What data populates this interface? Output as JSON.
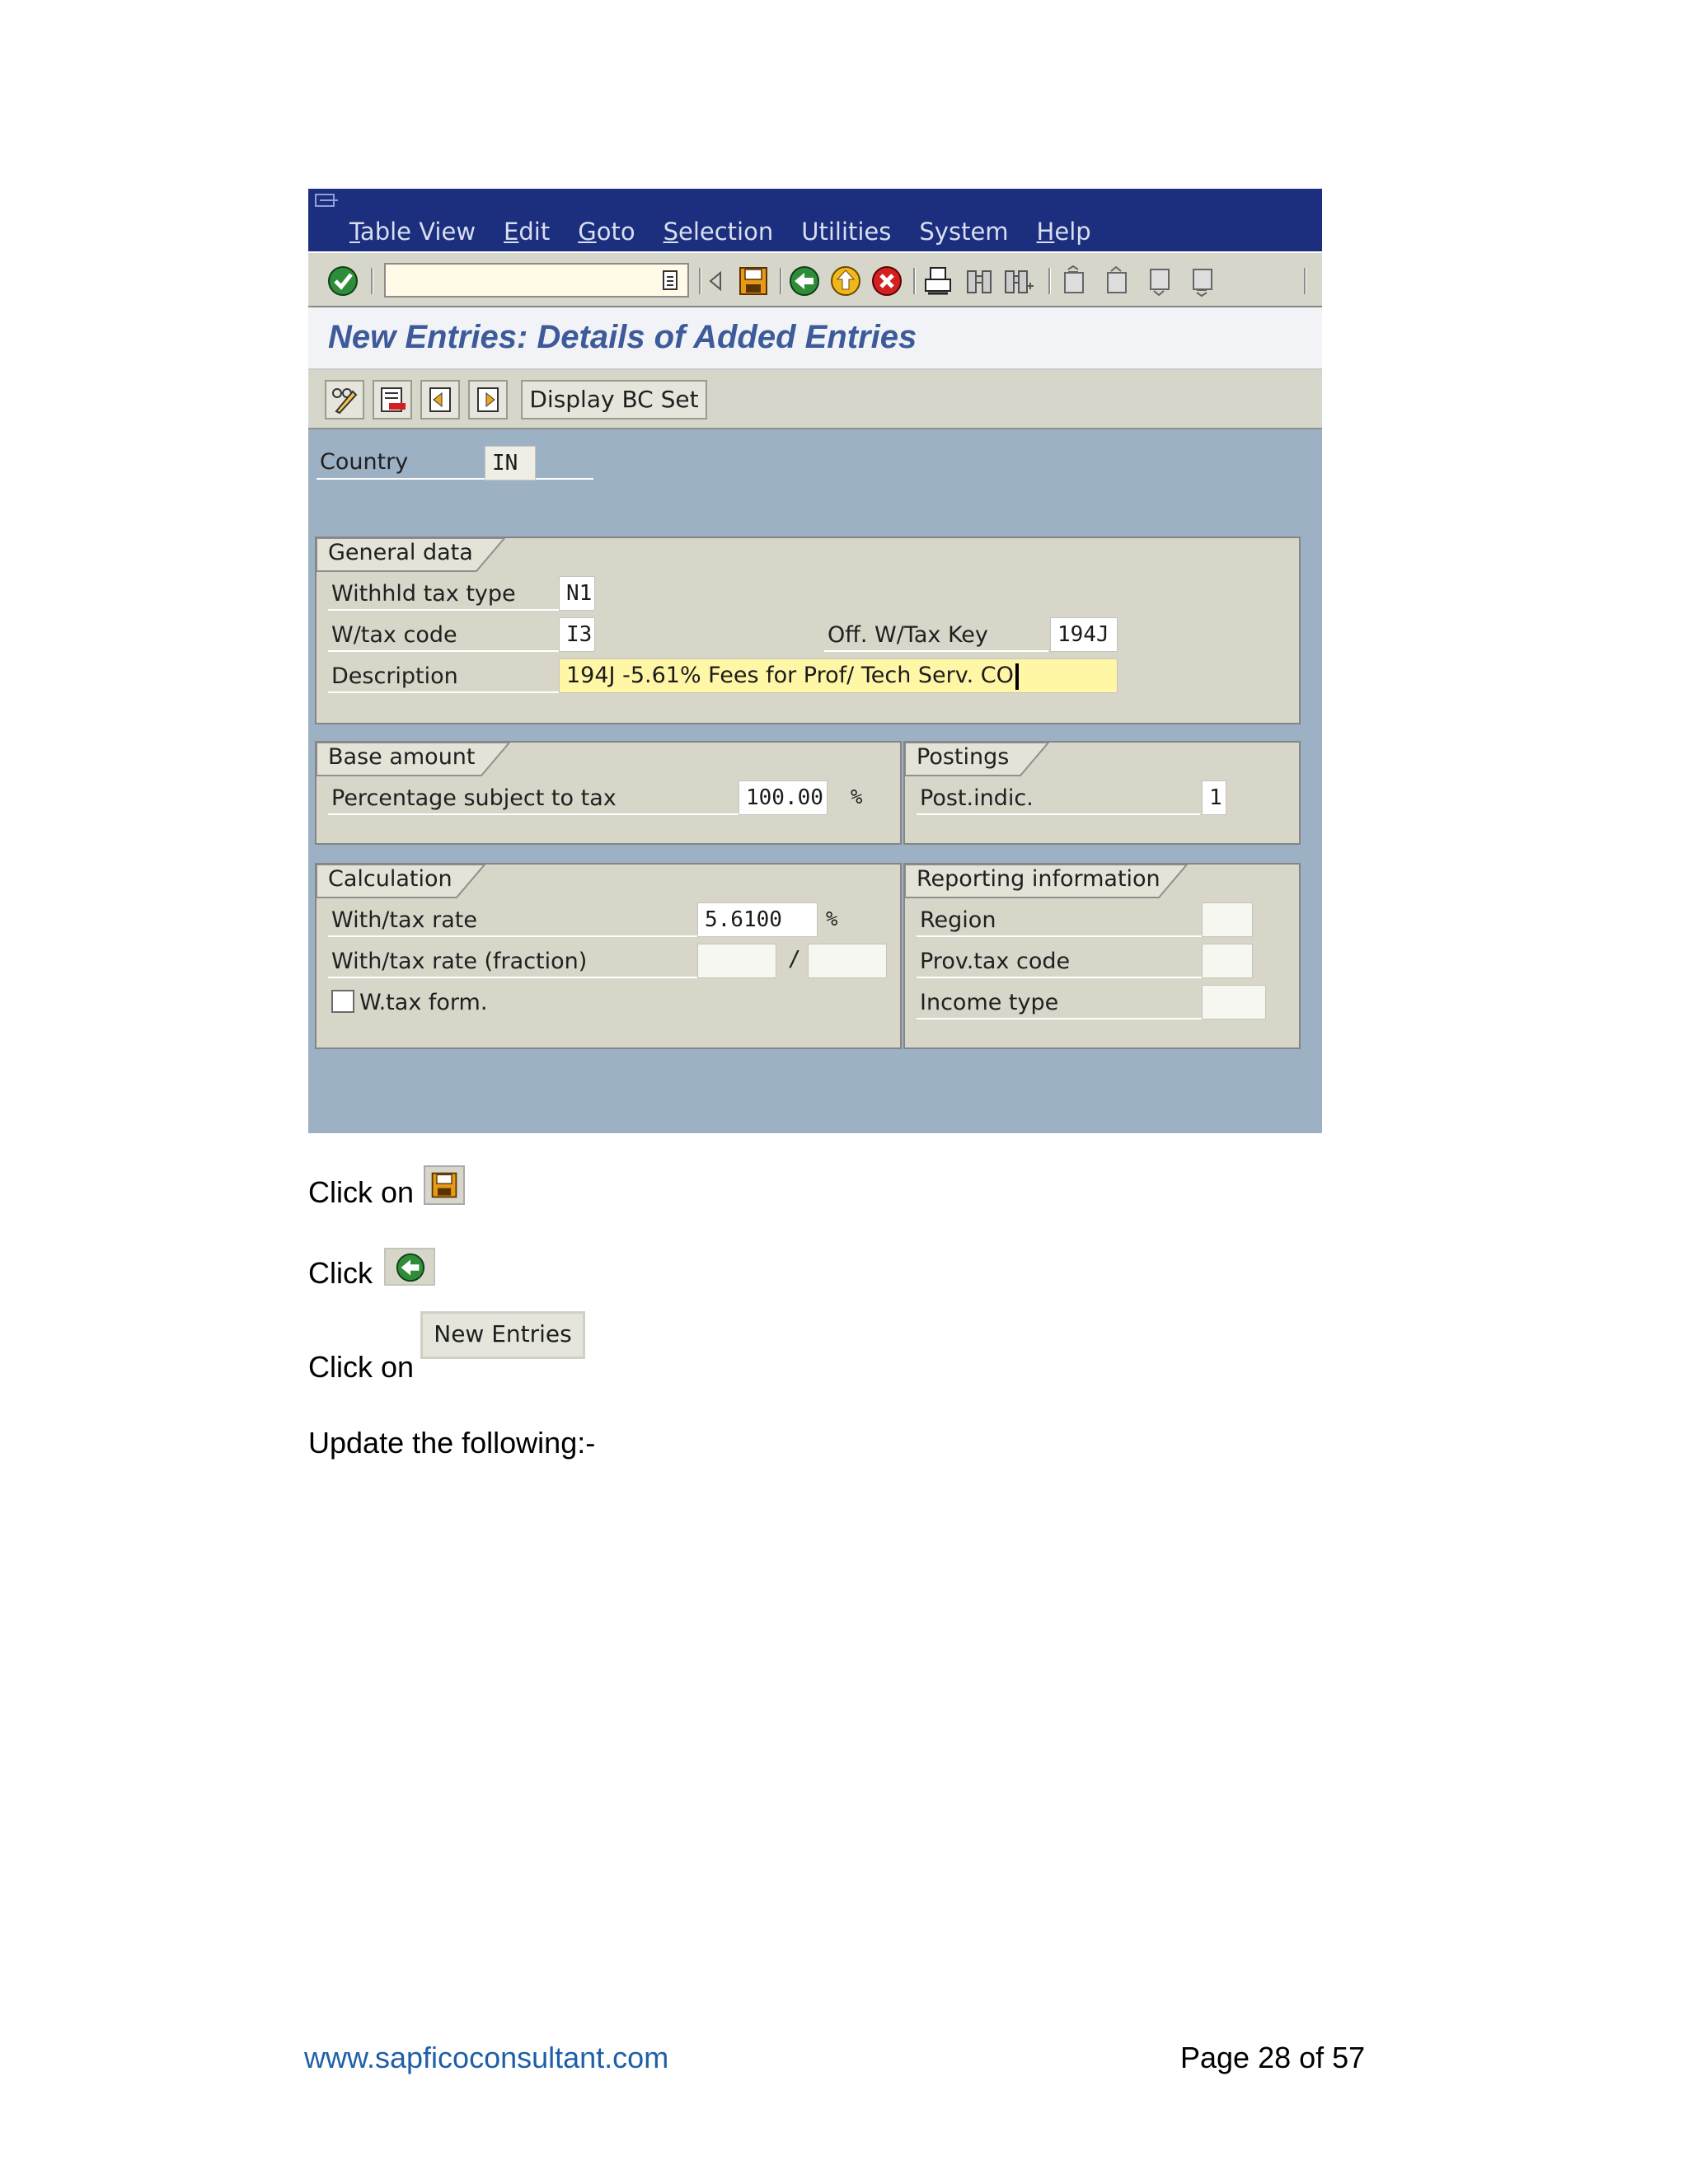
{
  "sap": {
    "menu": [
      {
        "accel": "T",
        "rest": "able View"
      },
      {
        "accel": "E",
        "rest": "dit"
      },
      {
        "accel": "G",
        "rest": "oto"
      },
      {
        "accel": "S",
        "rest": "election"
      },
      {
        "accel": "",
        "rest": "Utilities"
      },
      {
        "accel": "",
        "rest": "System"
      },
      {
        "accel": "H",
        "rest": "elp"
      }
    ],
    "command_field_value": "",
    "title": "New Entries: Details of Added Entries",
    "app_toolbar": {
      "display_bc_set_label": "Display BC Set"
    },
    "country": {
      "label": "Country",
      "value": "IN"
    },
    "general_data": {
      "title": "General data",
      "withhld_tax_type": {
        "label": "Withhld tax type",
        "value": "N1"
      },
      "wtax_code": {
        "label": "W/tax code",
        "value": "I3"
      },
      "off_wtax_key": {
        "label": "Off. W/Tax Key",
        "value": "194J"
      },
      "description": {
        "label": "Description",
        "value": "194J -5.61% Fees for Prof/ Tech Serv. CO"
      }
    },
    "base_amount": {
      "title": "Base amount",
      "percentage": {
        "label": "Percentage subject to tax",
        "value": "100.00",
        "unit": "%"
      }
    },
    "postings": {
      "title": "Postings",
      "post_indic": {
        "label": "Post.indic.",
        "value": "1"
      }
    },
    "calculation": {
      "title": "Calculation",
      "rate": {
        "label": "With/tax rate",
        "value": "5.6100",
        "unit": "%"
      },
      "rate_fraction": {
        "label": "With/tax rate (fraction)",
        "numerator": "",
        "separator": "/",
        "denominator": ""
      },
      "wtax_form": {
        "label": "W.tax form.",
        "checked": false
      }
    },
    "reporting": {
      "title": "Reporting information",
      "region": {
        "label": "Region",
        "value": ""
      },
      "prov_tax_code": {
        "label": "Prov.tax code",
        "value": ""
      },
      "income_type": {
        "label": "Income type",
        "value": ""
      }
    }
  },
  "doc": {
    "step1": "Click on",
    "step2": "Click",
    "step3": "Click on",
    "new_entries_label": "New Entries",
    "step4": "Update the following:-",
    "footer_url": "www.sapficoconsultant.com",
    "footer_page": "Page 28 of 57"
  },
  "icons": {
    "enter": "check-circle-icon",
    "save": "floppy-icon",
    "back": "back-arrow-icon",
    "exit": "exit-up-icon",
    "cancel": "cancel-x-icon",
    "print": "printer-icon",
    "find": "binoculars-icon",
    "find_next": "binoculars-plus-icon",
    "first_page": "first-page-icon",
    "prev_page": "prev-page-icon",
    "next_page": "next-page-icon",
    "last_page": "last-page-icon"
  },
  "colors": {
    "menubar": "#1b2f7e",
    "screen_bg": "#9db1c4",
    "group_bg": "#d7d6c9",
    "title_color": "#3d5a9a",
    "link": "#1f5fa8"
  }
}
